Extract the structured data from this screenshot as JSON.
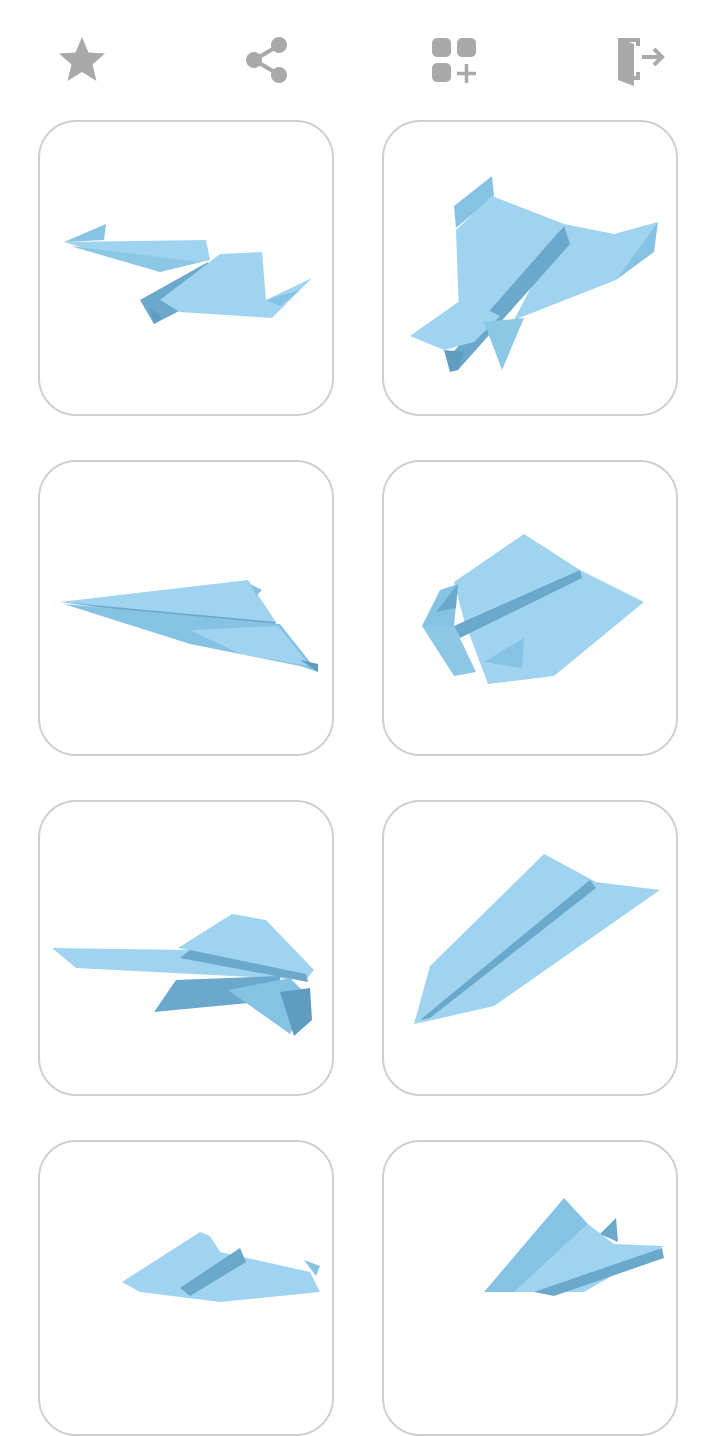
{
  "toolbar": {
    "icons": [
      "star-icon",
      "share-icon",
      "add-apps-icon",
      "exit-icon"
    ],
    "icon_color": "#a9a9a9"
  },
  "theme": {
    "card_border": "#cfcfcf",
    "paper_light": "#9fd3ef",
    "paper_mid": "#86c2e3",
    "paper_dark": "#6aa8cc"
  },
  "planes": [
    {
      "id": "plane-1"
    },
    {
      "id": "plane-2"
    },
    {
      "id": "plane-3"
    },
    {
      "id": "plane-4"
    },
    {
      "id": "plane-5"
    },
    {
      "id": "plane-6"
    },
    {
      "id": "plane-7"
    },
    {
      "id": "plane-8"
    }
  ]
}
